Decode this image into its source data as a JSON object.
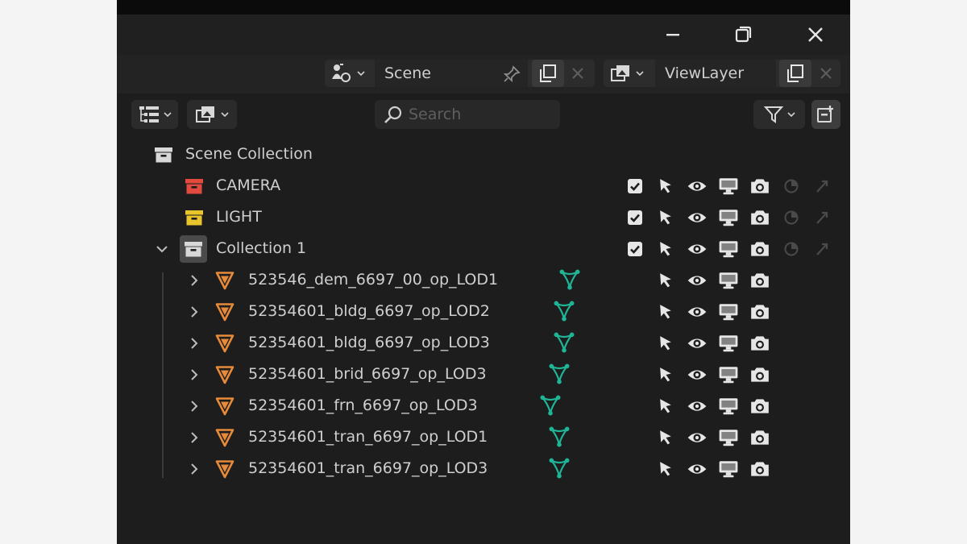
{
  "header": {
    "scene_label": "Scene",
    "view_layer_label": "ViewLayer"
  },
  "toolbar": {
    "search_placeholder": "Search"
  },
  "colors": {
    "camera_collection": "#e04a3f",
    "light_collection": "#e8c52d",
    "object_orange": "#e78a3a",
    "geometry_nodes_teal": "#1fb597"
  },
  "outliner": {
    "scene_collection": "Scene Collection",
    "collections": [
      {
        "name": "CAMERA",
        "color_tag": "red"
      },
      {
        "name": "LIGHT",
        "color_tag": "yellow"
      },
      {
        "name": "Collection 1",
        "color_tag": "none",
        "expanded": true
      }
    ],
    "objects": [
      {
        "name": "523546_dem_6697_00_op_LOD1"
      },
      {
        "name": "52354601_bldg_6697_op_LOD2"
      },
      {
        "name": "52354601_bldg_6697_op_LOD3"
      },
      {
        "name": "52354601_brid_6697_op_LOD3"
      },
      {
        "name": "52354601_frn_6697_op_LOD3"
      },
      {
        "name": "52354601_tran_6697_op_LOD1"
      },
      {
        "name": "52354601_tran_6697_op_LOD3"
      }
    ]
  }
}
